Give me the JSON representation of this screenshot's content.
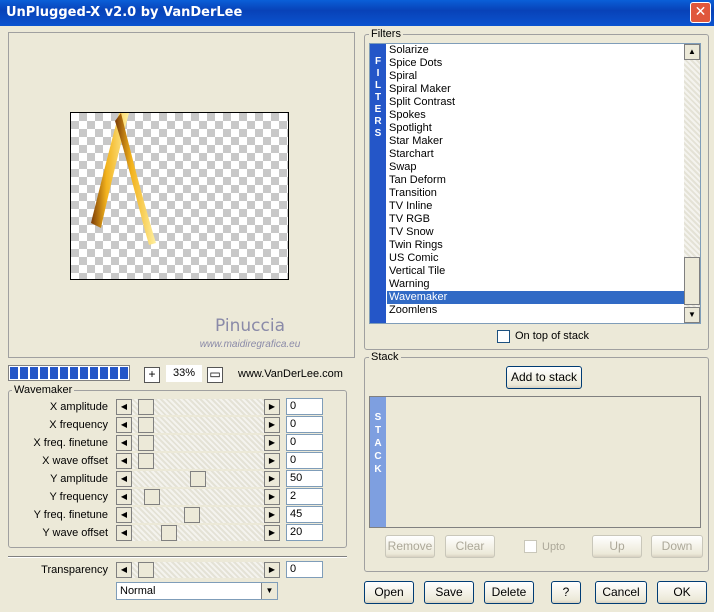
{
  "window": {
    "title": "UnPlugged-X v2.0 by VanDerLee",
    "close_glyph": "✕"
  },
  "preview": {
    "watermark": "Pinuccia",
    "watermark_url": "www.maidiregrafica.eu",
    "progress": 1.0,
    "zoom_in_glyph": "+",
    "zoom": "33%",
    "fit_glyph": "▭",
    "site": "www.VanDerLee.com"
  },
  "filters": {
    "group_label": "Filters",
    "strip_letters": [
      "F",
      "I",
      "L",
      "T",
      "E",
      "R",
      "S"
    ],
    "items": [
      "Solarize",
      "Spice Dots",
      "Spiral",
      "Spiral Maker",
      "Split Contrast",
      "Spokes",
      "Spotlight",
      "Star Maker",
      "Starchart",
      "Swap",
      "Tan Deform",
      "Transition",
      "TV Inline",
      "TV RGB",
      "TV Snow",
      "Twin Rings",
      "US Comic",
      "Vertical Tile",
      "Warning",
      "Wavemaker",
      "Zoomlens"
    ],
    "selected": "Wavemaker",
    "on_top_label": "On top of stack",
    "up_arrow": "▲",
    "down_arrow": "▼"
  },
  "stack": {
    "group_label": "Stack",
    "add_label": "Add to stack",
    "strip_letters": [
      "S",
      "T",
      "A",
      "C",
      "K"
    ],
    "remove_label": "Remove",
    "clear_label": "Clear",
    "upto_label": "Upto",
    "up_label": "Up",
    "down_label": "Down"
  },
  "wavemaker": {
    "group_label": "Wavemaker",
    "left_arrow": "◀",
    "right_arrow": "▶",
    "params": [
      {
        "label": "X amplitude",
        "value": "0",
        "level": 0.05
      },
      {
        "label": "X frequency",
        "value": "0",
        "level": 0.05
      },
      {
        "label": "X freq. finetune",
        "value": "0",
        "level": 0.05
      },
      {
        "label": "X wave offset",
        "value": "0",
        "level": 0.05
      },
      {
        "label": "Y amplitude",
        "value": "50",
        "level": 0.5
      },
      {
        "label": "Y frequency",
        "value": "2",
        "level": 0.1
      },
      {
        "label": "Y freq. finetune",
        "value": "45",
        "level": 0.45
      },
      {
        "label": "Y wave offset",
        "value": "20",
        "level": 0.25
      }
    ],
    "transparency": {
      "label": "Transparency",
      "value": "0",
      "level": 0.05
    },
    "blend_mode": "Normal",
    "dropdown_arrow": "▼"
  },
  "buttons": {
    "open": "Open",
    "save": "Save",
    "delete": "Delete",
    "help": "?",
    "cancel": "Cancel",
    "ok": "OK"
  }
}
